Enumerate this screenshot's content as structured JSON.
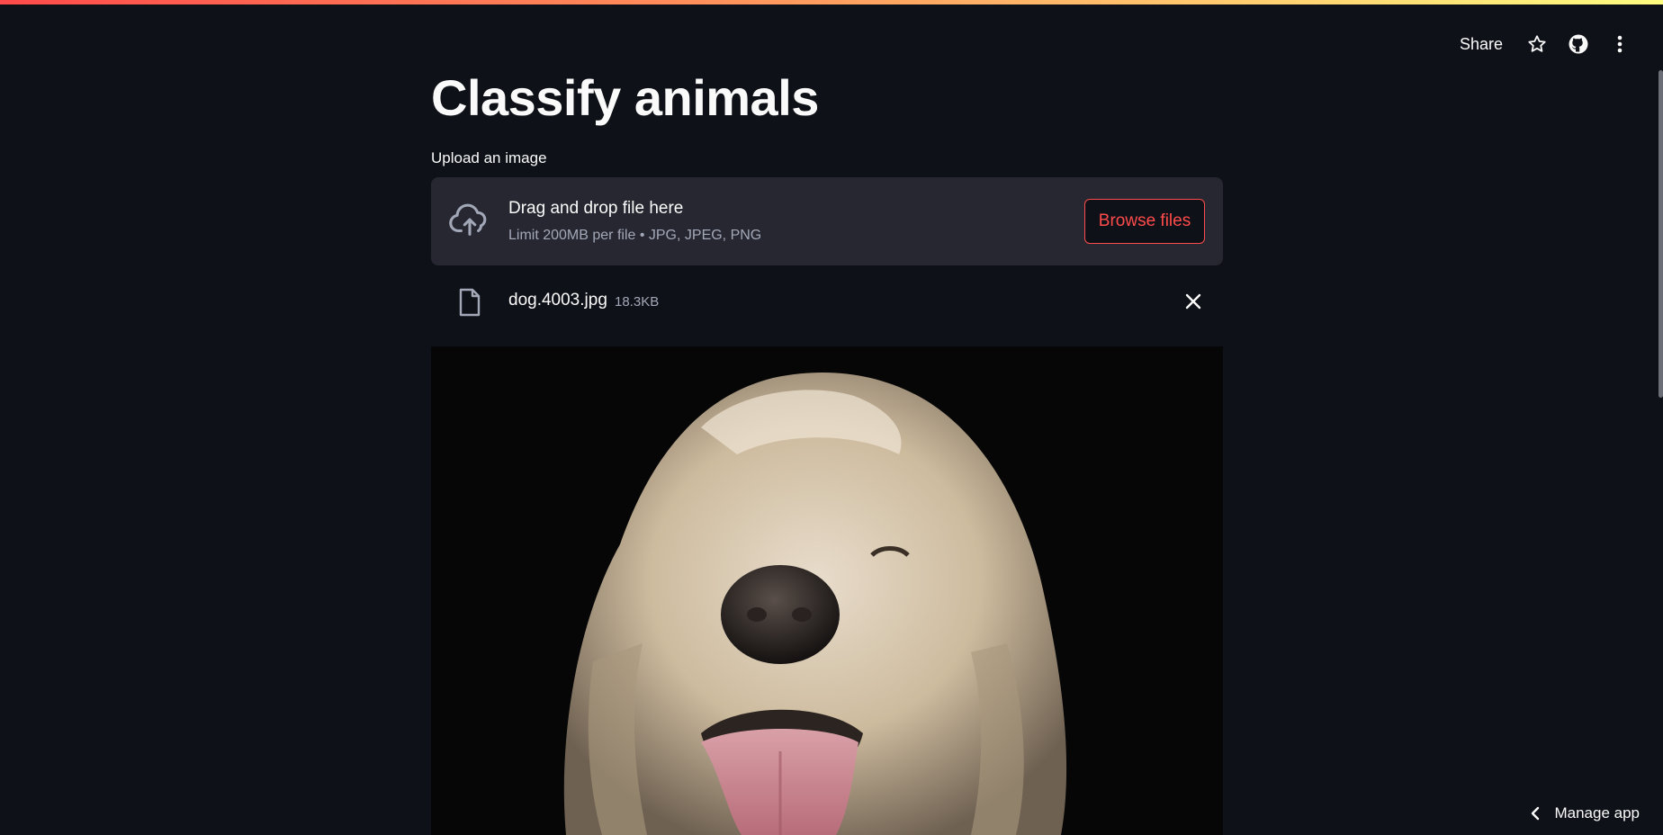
{
  "header": {
    "share_label": "Share",
    "icons": [
      "star-icon",
      "github-icon",
      "kebab-menu-icon"
    ],
    "accent_gradient": [
      "#ff4b4b",
      "#ff8c5a",
      "#fffd80"
    ]
  },
  "main": {
    "title": "Classify animals",
    "uploader": {
      "label": "Upload an image",
      "drop_text": "Drag and drop file here",
      "limit_text": "Limit 200MB per file • JPG, JPEG, PNG",
      "browse_label": "Browse files"
    },
    "uploaded_file": {
      "name": "dog.4003.jpg",
      "size": "18.3KB"
    }
  },
  "footer": {
    "manage_label": "Manage app"
  },
  "colors": {
    "background": "#0e1117",
    "surface": "#262730",
    "accent": "#ff4b4b",
    "muted_text": "#a3a8b8"
  }
}
